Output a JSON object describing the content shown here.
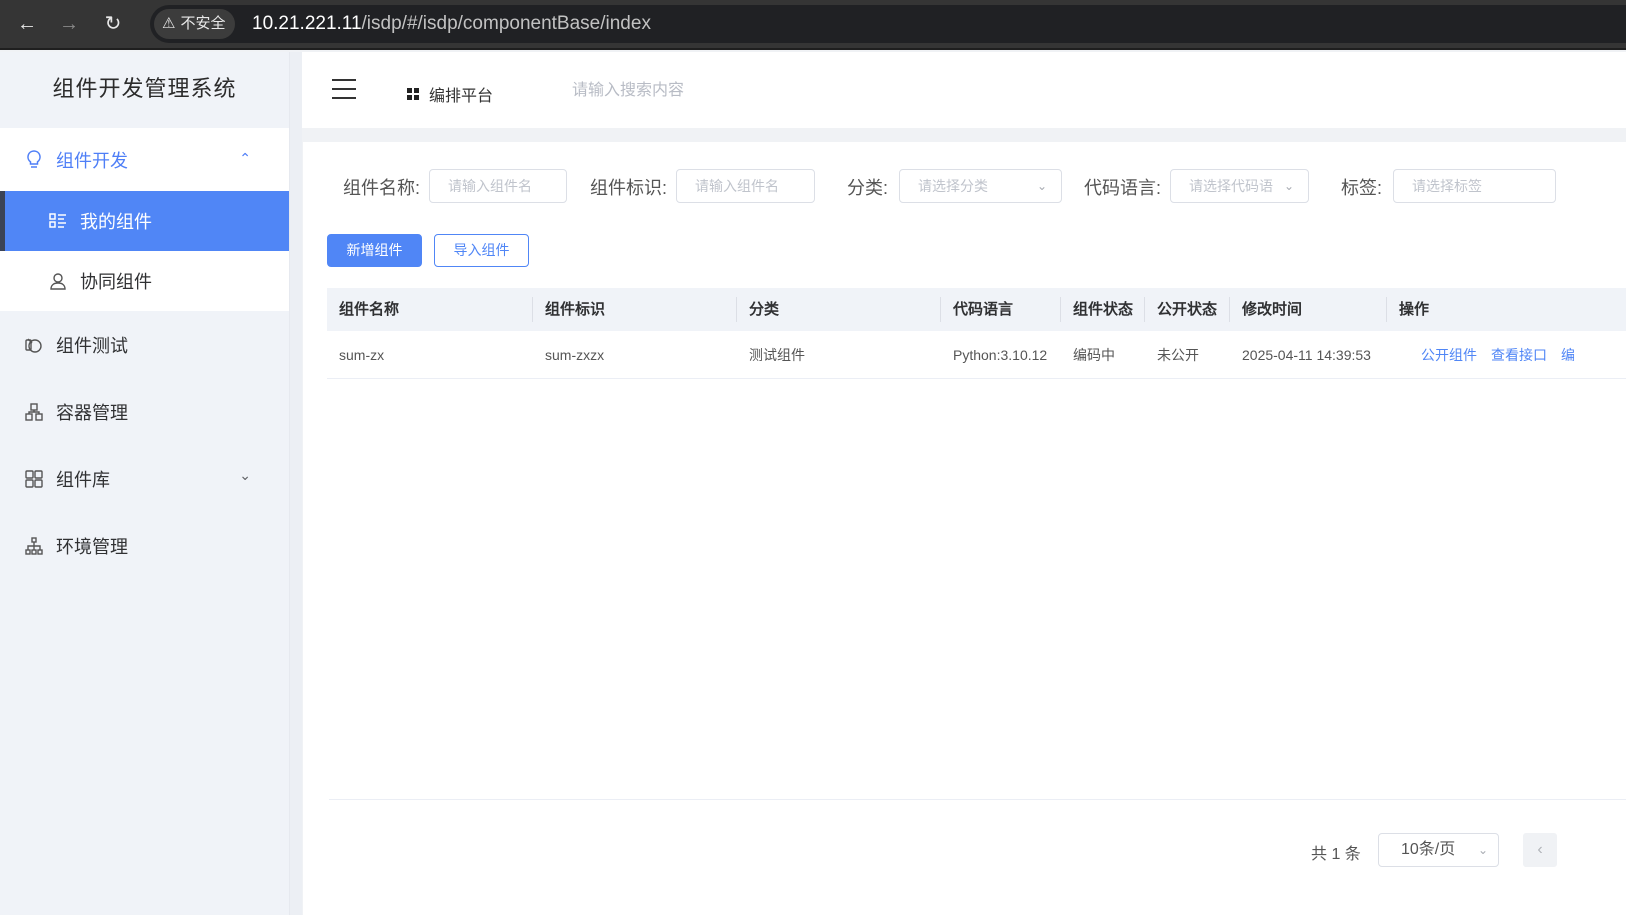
{
  "browser": {
    "security_label": "不安全",
    "url_host": "10.21.221.11",
    "url_path": "/isdp/#/isdp/componentBase/index"
  },
  "sidebar": {
    "brand": "组件开发管理系统",
    "menu": {
      "component_dev": "组件开发",
      "my_components": "我的组件",
      "collab_components": "协同组件",
      "component_test": "组件测试",
      "container_mgmt": "容器管理",
      "component_lib": "组件库",
      "env_mgmt": "环境管理"
    }
  },
  "header": {
    "platform": "编排平台",
    "search_placeholder": "请输入搜索内容"
  },
  "filters": {
    "name_label": "组件名称:",
    "name_placeholder": "请输入组件名",
    "id_label": "组件标识:",
    "id_placeholder": "请输入组件名",
    "category_label": "分类:",
    "category_placeholder": "请选择分类",
    "lang_label": "代码语言:",
    "lang_placeholder": "请选择代码语",
    "tag_label": "标签:",
    "tag_placeholder": "请选择标签"
  },
  "actions": {
    "add": "新增组件",
    "import": "导入组件"
  },
  "table": {
    "headers": [
      "组件名称",
      "组件标识",
      "分类",
      "代码语言",
      "组件状态",
      "公开状态",
      "修改时间",
      "操作"
    ],
    "rows": [
      {
        "name": "sum-zx",
        "identifier": "sum-zxzx",
        "category": "测试组件",
        "language": "Python:3.10.12",
        "status": "编码中",
        "public_status": "未公开",
        "modified": "2025-04-11 14:39:53",
        "ops": [
          "公开组件",
          "查看接口",
          "编"
        ]
      }
    ]
  },
  "pagination": {
    "total": "共 1 条",
    "page_size": "10条/页"
  }
}
